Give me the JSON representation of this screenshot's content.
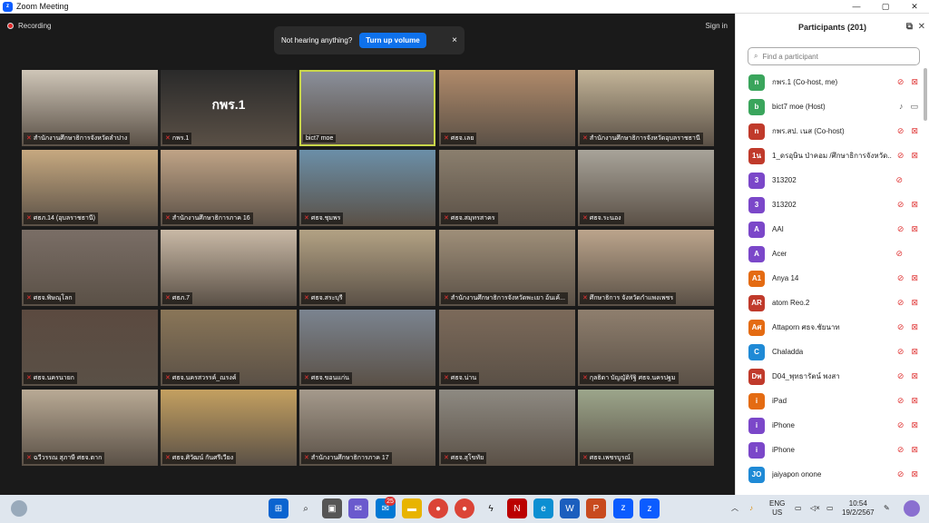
{
  "window": {
    "title": "Zoom Meeting",
    "min": "—",
    "max": "▢",
    "close": "✕"
  },
  "stage": {
    "recording": "Recording",
    "sign_in": "Sign in"
  },
  "toast": {
    "text": "Not hearing anything?",
    "button": "Turn up volume",
    "close": "×"
  },
  "tiles": [
    {
      "label": "สำนักงานศึกษาธิการจังหวัดลำปาง",
      "bg": "#cfc6b8",
      "muted": true
    },
    {
      "label": "กพร.1",
      "bg": "#2a2a2a",
      "muted": true,
      "name": "กพร.1"
    },
    {
      "label": "bict7 moe",
      "bg": "#8a8f9a",
      "muted": false,
      "selected": true
    },
    {
      "label": "ศธจ.เลย",
      "bg": "#b08a6a",
      "muted": true
    },
    {
      "label": "สำนักงานศึกษาธิการจังหวัดอุบลราชธานี",
      "bg": "#c4b598",
      "muted": true
    },
    {
      "label": "ศธภ.14 (อุบลราชธานี)",
      "bg": "#c7a980",
      "muted": true
    },
    {
      "label": "สำนักงานศึกษาธิการภาค 16",
      "bg": "#c0a486",
      "muted": true
    },
    {
      "label": "ศธจ.ชุมพร",
      "bg": "#6b8fa8",
      "muted": true
    },
    {
      "label": "ศธจ.สมุทรสาคร",
      "bg": "#8b7f6e",
      "muted": true
    },
    {
      "label": "ศธจ.ระนอง",
      "bg": "#a8a49a",
      "muted": true
    },
    {
      "label": "ศธจ.พิษณุโลก",
      "bg": "#7a6e66",
      "muted": true
    },
    {
      "label": "ศธภ.7",
      "bg": "#c9b9a6",
      "muted": true
    },
    {
      "label": "ศธจ.สระบุรี",
      "bg": "#b3a284",
      "muted": true
    },
    {
      "label": "สำนักงานศึกษาธิการจังหวัดพะเยา อ้นเค้...",
      "bg": "#9f8f79",
      "muted": true
    },
    {
      "label": "ศึกษาธิการ จังหวัดกำแพงเพชร",
      "bg": "#bca58c",
      "muted": true
    },
    {
      "label": "ศธจ.นครนายก",
      "bg": "#5b4a40",
      "muted": true
    },
    {
      "label": "ศธจ.นครสวรรค์_ณรงค์",
      "bg": "#8a7658",
      "muted": true
    },
    {
      "label": "ศธจ.ขอนแก่น",
      "bg": "#7b8490",
      "muted": true
    },
    {
      "label": "ศธจ.น่าน",
      "bg": "#7c6a5a",
      "muted": true
    },
    {
      "label": "กุลธิดา บัญญัติรัฐิ ศธจ.นครปฐม",
      "bg": "#8f7f6e",
      "muted": true
    },
    {
      "label": "ฉวีวรรณ สุภาษี ศธจ.ตาก",
      "bg": "#b9aa95",
      "muted": true
    },
    {
      "label": "ศธจ.ศิวัฒน์ กันศรีเวียง",
      "bg": "#c4a060",
      "muted": true
    },
    {
      "label": "สำนักงานศึกษาธิการภาค 17",
      "bg": "#a59a8c",
      "muted": true
    },
    {
      "label": "ศธจ.สุโขทัย",
      "bg": "#8e8a82",
      "muted": true
    },
    {
      "label": "ศธจ.เพชรบูรณ์",
      "bg": "#9ca68b",
      "muted": true
    }
  ],
  "panel": {
    "title": "Participants (201)",
    "search_placeholder": "Find a participant",
    "participants": [
      {
        "av": "n",
        "color": "#3aa55c",
        "name": "กพร.1 (Co-host, me)",
        "mic": "muted",
        "cam": "off"
      },
      {
        "av": "b",
        "color": "#3aa55c",
        "name": "bict7 moe (Host)",
        "mic": "on",
        "cam": "on"
      },
      {
        "av": "n",
        "color": "#c03a2b",
        "name": "กพร.สป. เนส (Co-host)",
        "mic": "muted",
        "cam": "off"
      },
      {
        "av": "1น",
        "color": "#c03a2b",
        "name": "1_ดรอุษิน ป่าคอม /ศึกษาธิการจังหวัด...",
        "mic": "muted",
        "cam": "off"
      },
      {
        "av": "3",
        "color": "#7b47c9",
        "name": "313202",
        "mic": "muted",
        "cam": ""
      },
      {
        "av": "3",
        "color": "#7b47c9",
        "name": "313202",
        "mic": "muted",
        "cam": "off"
      },
      {
        "av": "A",
        "color": "#7b47c9",
        "name": "AAI",
        "mic": "muted",
        "cam": "off"
      },
      {
        "av": "A",
        "color": "#7b47c9",
        "name": "Acer",
        "mic": "muted",
        "cam": ""
      },
      {
        "av": "A1",
        "color": "#e46b12",
        "name": "Anya 14",
        "mic": "muted",
        "cam": "off"
      },
      {
        "av": "AR",
        "color": "#c03a2b",
        "name": "atom Reo.2",
        "mic": "muted",
        "cam": "off"
      },
      {
        "av": "Aศ",
        "color": "#e46b12",
        "name": "Attaporn ศธจ.ชัยนาท",
        "mic": "muted",
        "cam": "off"
      },
      {
        "av": "C",
        "color": "#1f8ad6",
        "name": "Chaladda",
        "mic": "muted",
        "cam": "off"
      },
      {
        "av": "Dพ",
        "color": "#c03a2b",
        "name": "D04_พุทธารัตน์ พงสา",
        "mic": "muted",
        "cam": "off"
      },
      {
        "av": "i",
        "color": "#e46b12",
        "name": "iPad",
        "mic": "muted",
        "cam": "off"
      },
      {
        "av": "i",
        "color": "#7b47c9",
        "name": "iPhone",
        "mic": "muted",
        "cam": "off"
      },
      {
        "av": "i",
        "color": "#7b47c9",
        "name": "iPhone",
        "mic": "muted",
        "cam": "off"
      },
      {
        "av": "JO",
        "color": "#1f8ad6",
        "name": "jaiyapon onone",
        "mic": "muted",
        "cam": "off"
      }
    ]
  },
  "taskbar": {
    "badge": "25",
    "lang1": "ENG",
    "lang2": "US",
    "time": "10:54",
    "date": "19/2/2567"
  }
}
